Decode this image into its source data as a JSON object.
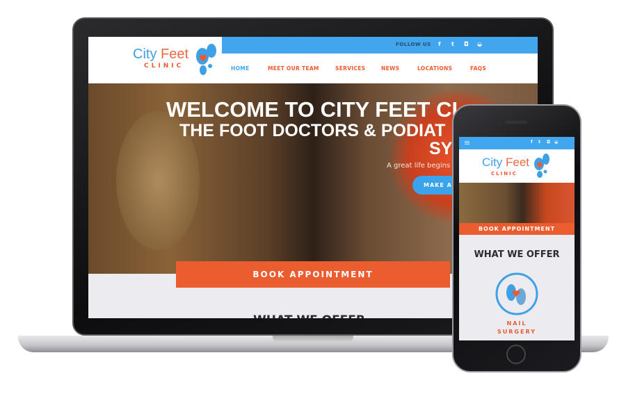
{
  "site": {
    "logo": {
      "city": "City",
      "feet": "Feet",
      "clinic": "CLINIC"
    },
    "follow_label": "FOLLOW US",
    "social_icons": [
      "facebook-icon",
      "twitter-icon",
      "instagram-icon",
      "chat-icon"
    ],
    "social_glyphs": [
      "f",
      "t",
      "◘",
      "◒"
    ],
    "nav": [
      "HOME",
      "MEET OUR TEAM",
      "SERVICES",
      "NEWS",
      "LOCATIONS",
      "FAQS"
    ],
    "hero": {
      "title_line1": "WELCOME TO CITY FEET CL",
      "title_line2": "THE FOOT DOCTORS & PODIAT",
      "title_line3": "SYD",
      "subtitle": "A great life begins fro",
      "cta": "MAKE AN"
    },
    "book_label": "BOOK APPOINTMENT",
    "section_title": "WHAT WE OFFER",
    "service": "NAIL",
    "service_line2": "SURGERY",
    "menu_glyph": "≡"
  },
  "colors": {
    "brand_blue": "#41a6ee",
    "brand_orange": "#eb5c2f"
  }
}
